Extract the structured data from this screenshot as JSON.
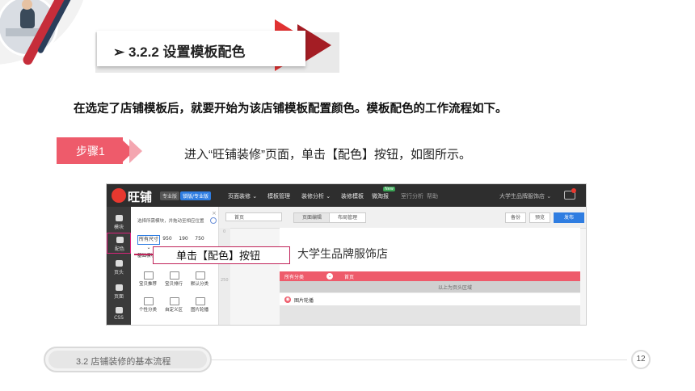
{
  "slide": {
    "title": "➢ 3.2.2  设置模板配色",
    "intro": "在选定了店铺模板后，就要开始为该店铺模板配置颜色。模板配色的工作流程如下。",
    "step_label": "步骤1",
    "step_text": "进入“旺铺装修”页面，单击【配色】按钮，如图所示。",
    "callout": "单击【配色】按钮",
    "footer_label": "3.2  店铺装修的基本流程",
    "page_number": "12"
  },
  "screenshot": {
    "logo": "旺铺",
    "badge_pro": "专业版",
    "badge_upgrade": "锁版/专业版",
    "nav": [
      "页面装修 ⌄",
      "模板管理",
      "装修分析 ⌄",
      "装修模板",
      "微淘报"
    ],
    "nav_new_tag": "New",
    "nav_dim": [
      "室行分析",
      "帮助"
    ],
    "shop_name": "大学生品牌服饰店 ⌄",
    "left_items": [
      {
        "label": "模块",
        "icon": "grid-icon"
      },
      {
        "label": "配色",
        "icon": "palette-icon"
      },
      {
        "label": "页头",
        "icon": "header-icon"
      },
      {
        "label": "页面",
        "icon": "page-icon"
      },
      {
        "label": "CSS",
        "icon": "code-icon"
      }
    ],
    "panel_hint": "选择所需模块，并拖动至相应位置",
    "panel_close": "×",
    "widths": [
      "所有尺寸 ⌄",
      "950",
      "190",
      "750"
    ],
    "category": "基础模块",
    "modules": [
      {
        "label": "宝贝推荐"
      },
      {
        "label": "宝贝排行"
      },
      {
        "label": "默认分类"
      },
      {
        "label": "个性分类"
      },
      {
        "label": "自定义区"
      },
      {
        "label": "图片轮播"
      }
    ],
    "page_select": "首页",
    "tabs": [
      "页面编辑",
      "布局管理"
    ],
    "buttons": [
      "备份",
      "预览",
      "发布"
    ],
    "ruler_marks": [
      "0",
      "250"
    ],
    "banner_title": "大学生品牌服饰店",
    "pink_bar": [
      "所有分类",
      "首页"
    ],
    "grey_strip": "以上为页头区域",
    "slider_label": "图片轮播"
  }
}
